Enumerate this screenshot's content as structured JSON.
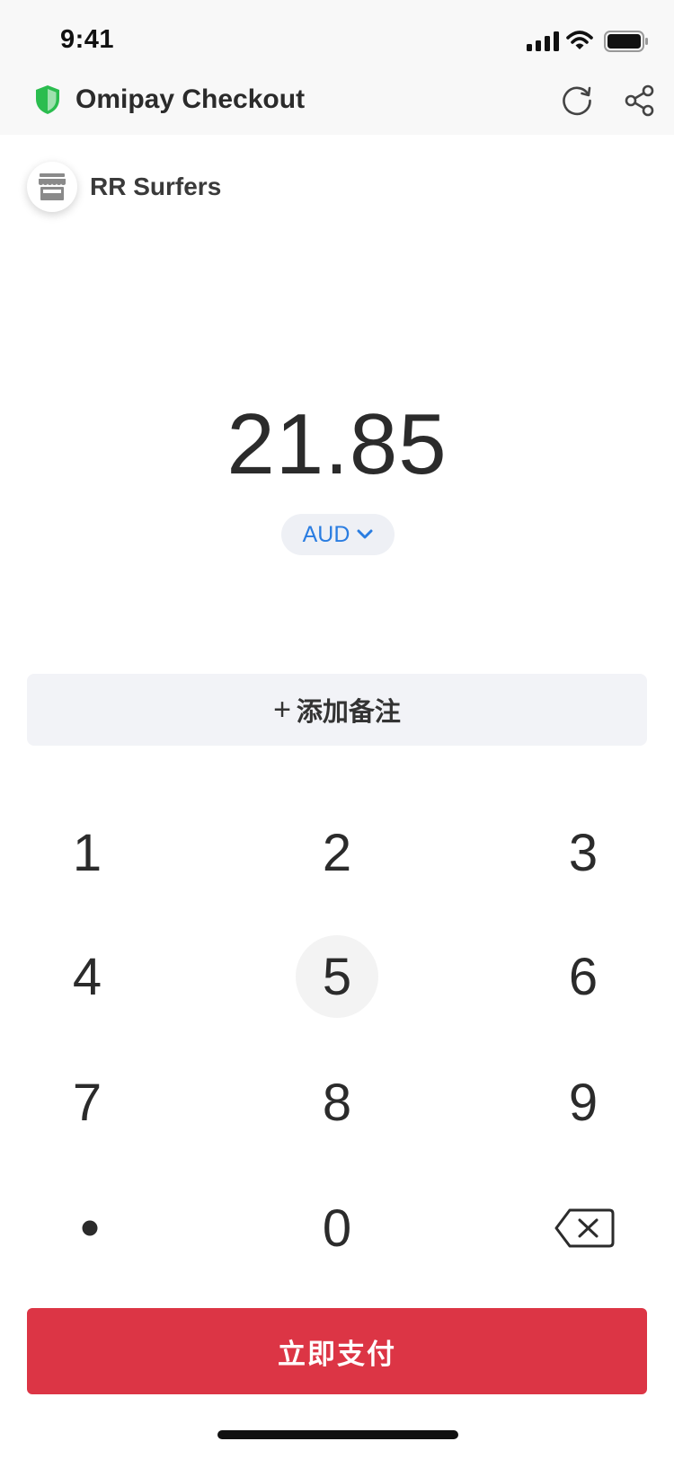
{
  "status_bar": {
    "time": "9:41",
    "icons": [
      "cellular-signal-icon",
      "wifi-icon",
      "battery-icon"
    ]
  },
  "nav": {
    "title": "Omipay Checkout",
    "icons": [
      "shield-icon",
      "refresh-icon",
      "share-icon"
    ],
    "shield_color": "#2bbd4f"
  },
  "merchant": {
    "name": "RR Surfers",
    "icon": "store-icon"
  },
  "payment": {
    "amount": "21.85",
    "currency": "AUD",
    "currency_color": "#2a7de1"
  },
  "note": {
    "plus": "+",
    "label": "添加备注"
  },
  "keypad": {
    "keys": [
      "1",
      "2",
      "3",
      "4",
      "5",
      "6",
      "7",
      "8",
      "9",
      "•",
      "0",
      "⌫"
    ],
    "pressed_key": "5"
  },
  "pay_button": {
    "label": "立即支付",
    "color": "#dc3545"
  }
}
